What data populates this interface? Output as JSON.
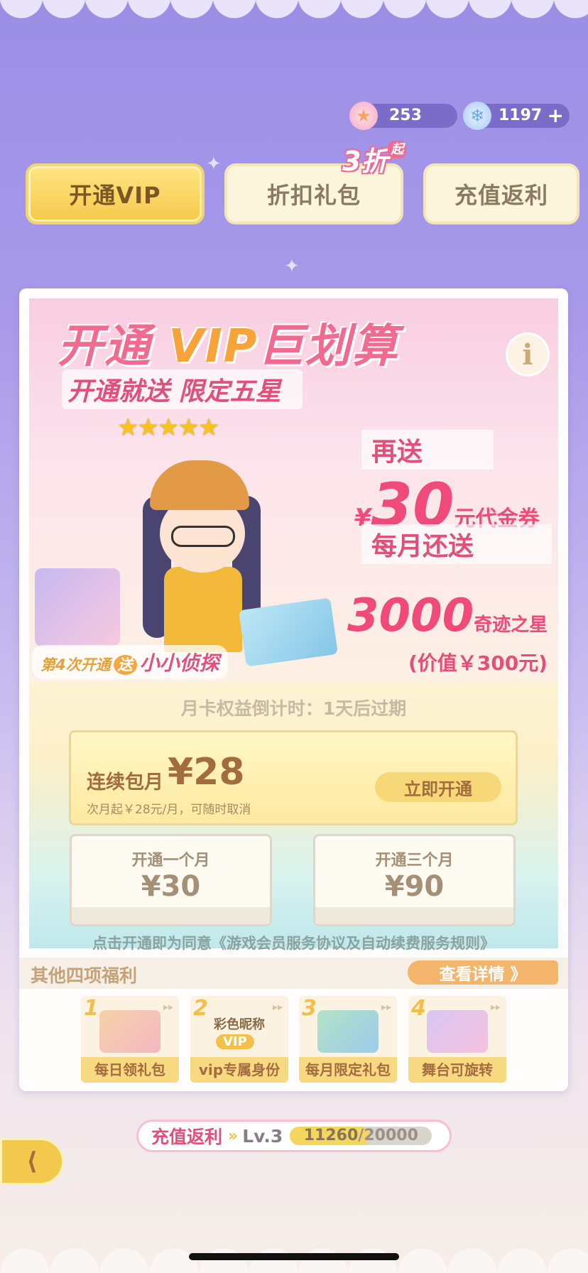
{
  "currency": {
    "stars": {
      "icon": "star-coin-icon",
      "value": "253"
    },
    "diamonds": {
      "icon": "diamond-coin-icon",
      "value": "1197",
      "add": "+"
    }
  },
  "tabs": [
    {
      "label": "开通VIP",
      "selected": true
    },
    {
      "label": "折扣礼包",
      "selected": false
    },
    {
      "label": "充值返利",
      "selected": false
    }
  ],
  "discount_badge": {
    "text": "3折",
    "suffix": "起"
  },
  "banner": {
    "headline_a": "开通",
    "headline_vip": "VIP",
    "headline_b": "巨划算",
    "info": "i",
    "subhead": "开通就送 限定五星",
    "stars": "★★★★★",
    "resend": "再送",
    "yen": "¥",
    "amount": "30",
    "amount_unit": "元代金券",
    "monthly": "每月还送",
    "stars_amount": "3000",
    "stars_unit": "奇迹之星",
    "value_note": "(价值￥300元)",
    "gift4_prefix": "第4次开通",
    "gift4_song": "送",
    "gift4_name": "小小侦探"
  },
  "countdown": "月卡权益倒计时：1天后过期",
  "plans": {
    "auto": {
      "label": "连续包月",
      "price": "¥28",
      "note": "次月起￥28元/月，可随时取消",
      "button": "立即开通"
    },
    "one_month": {
      "title": "开通一个月",
      "price": "¥30"
    },
    "three_months": {
      "title": "开通三个月",
      "price": "¥90"
    }
  },
  "agreement": "点击开通即为同意《游戏会员服务协议及自动续费服务规则》",
  "benefits": {
    "title": "其他四项福利",
    "details": "查看详情 》",
    "items": [
      {
        "index": "1",
        "label": "每日领礼包",
        "icon": "gift-box-icon"
      },
      {
        "index": "2",
        "label": "vip专属身份",
        "pic_text": "彩色昵称",
        "chip": "VIP",
        "icon": "vip-badge-icon"
      },
      {
        "index": "3",
        "label": "每月限定礼包",
        "icon": "frame-gift-icon"
      },
      {
        "index": "4",
        "label": "舞台可旋转",
        "icon": "stage-icon"
      }
    ],
    "arrows": "▸▸"
  },
  "rebate": {
    "label": "充值返利",
    "arrow": "»",
    "level": "Lv.3",
    "current": "11260",
    "target": "20000",
    "progress": 0.563
  },
  "back": "⟨"
}
